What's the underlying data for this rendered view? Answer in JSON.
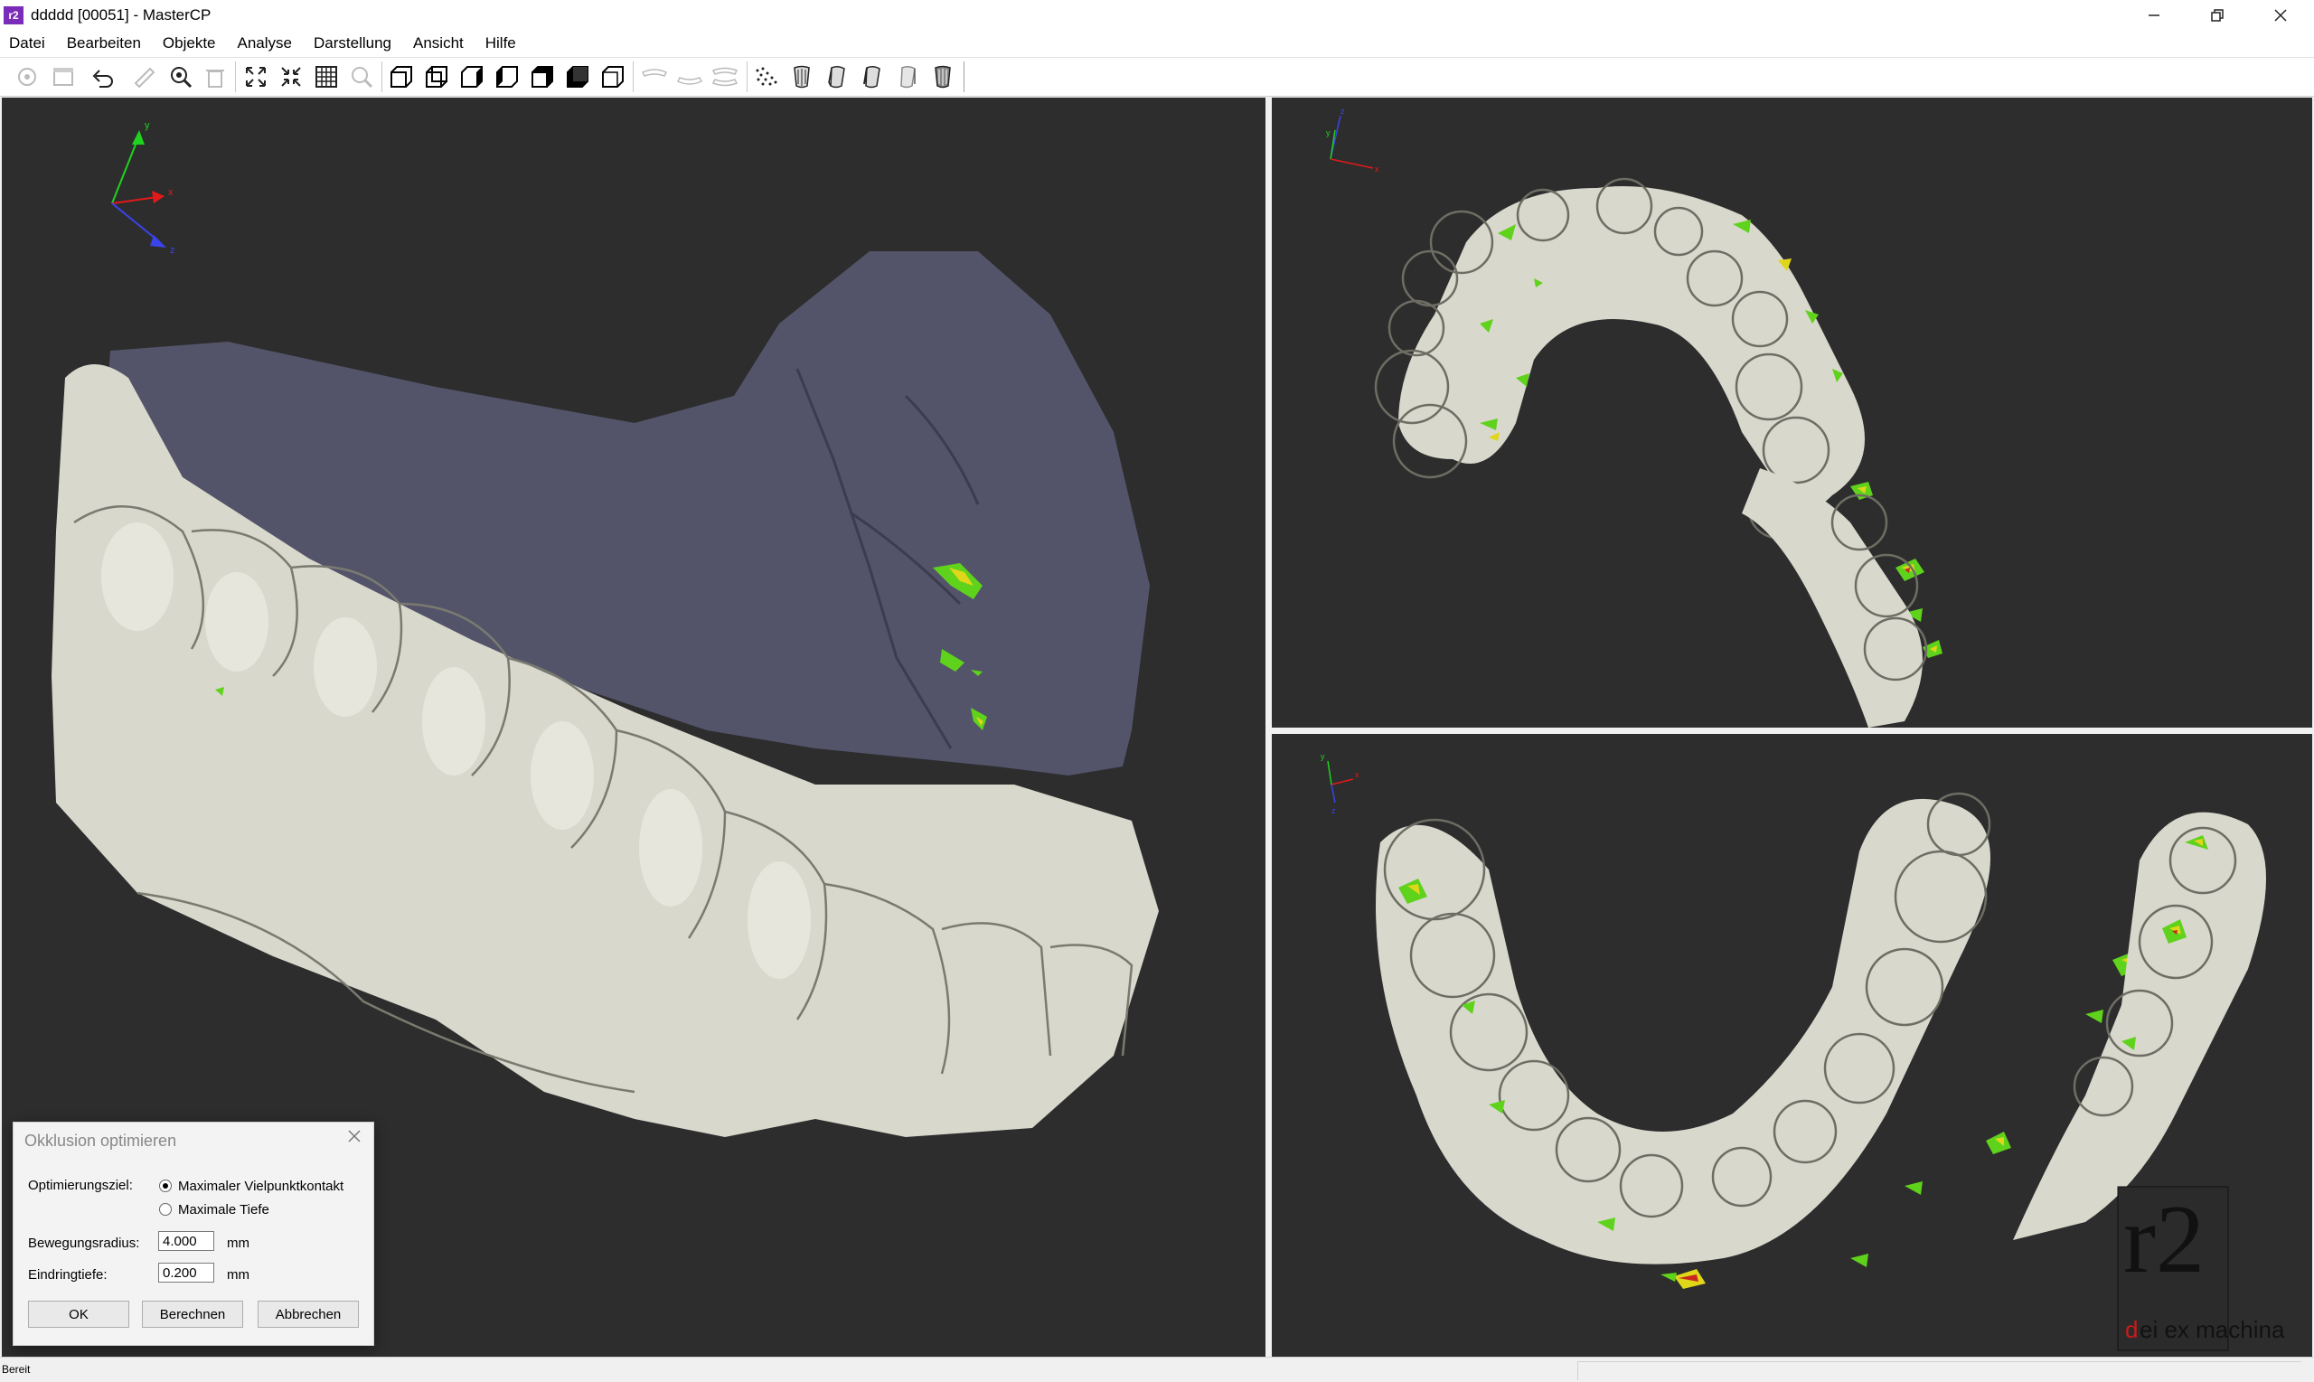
{
  "window": {
    "title": "ddddd [00051] - MasterCP",
    "app_icon_text": "r2",
    "minimize_icon": "minimize-icon",
    "restore_icon": "restore-icon",
    "close_icon": "close-icon"
  },
  "menu": {
    "items": [
      "Datei",
      "Bearbeiten",
      "Objekte",
      "Analyse",
      "Darstellung",
      "Ansicht",
      "Hilfe"
    ]
  },
  "toolbar": {
    "icons": [
      "settings-disabled-icon",
      "archive-disabled-icon",
      "undo-icon",
      "measure-disabled-icon",
      "zoom-icon",
      "delete-disabled-icon",
      "fit-view-icon",
      "shrink-view-icon",
      "grid-icon",
      "search-disabled-icon",
      "cube-front-icon",
      "cube-back-icon",
      "cube-right-icon",
      "cube-left-icon",
      "cube-top-icon",
      "cube-bottom-icon",
      "cube-iso-icon",
      "jaw-upper-icon",
      "jaw-lower-icon",
      "jaw-both-icon",
      "dots-icon",
      "tooth-1-icon",
      "tooth-2-icon",
      "tooth-3-icon",
      "tooth-4-icon",
      "tooth-5-icon"
    ]
  },
  "axes": {
    "x": "x",
    "y": "y",
    "z": "z"
  },
  "logo": {
    "big": "r2",
    "tagline_red": "d",
    "tagline_rest": "ei ex machina"
  },
  "dialog": {
    "title": "Okklusion optimieren",
    "goal_label": "Optimierungsziel:",
    "option_1": "Maximaler Vielpunktkontakt",
    "option_2": "Maximale Tiefe",
    "selected_option": 1,
    "radius_label": "Bewegungsradius:",
    "radius_value": "4.000",
    "radius_unit": "mm",
    "depth_label": "Eindringtiefe:",
    "depth_value": "0.200",
    "depth_unit": "mm",
    "ok": "OK",
    "compute": "Berechnen",
    "cancel": "Abbrechen"
  },
  "status": {
    "text": "Bereit"
  },
  "colors": {
    "viewport_bg": "#2d2d2d",
    "tooth": "#d9d8cd",
    "gum_overlay": "#55556a",
    "contact_green": "#5fd21c",
    "contact_yellow": "#e0d61a",
    "contact_red": "#c8281e"
  }
}
